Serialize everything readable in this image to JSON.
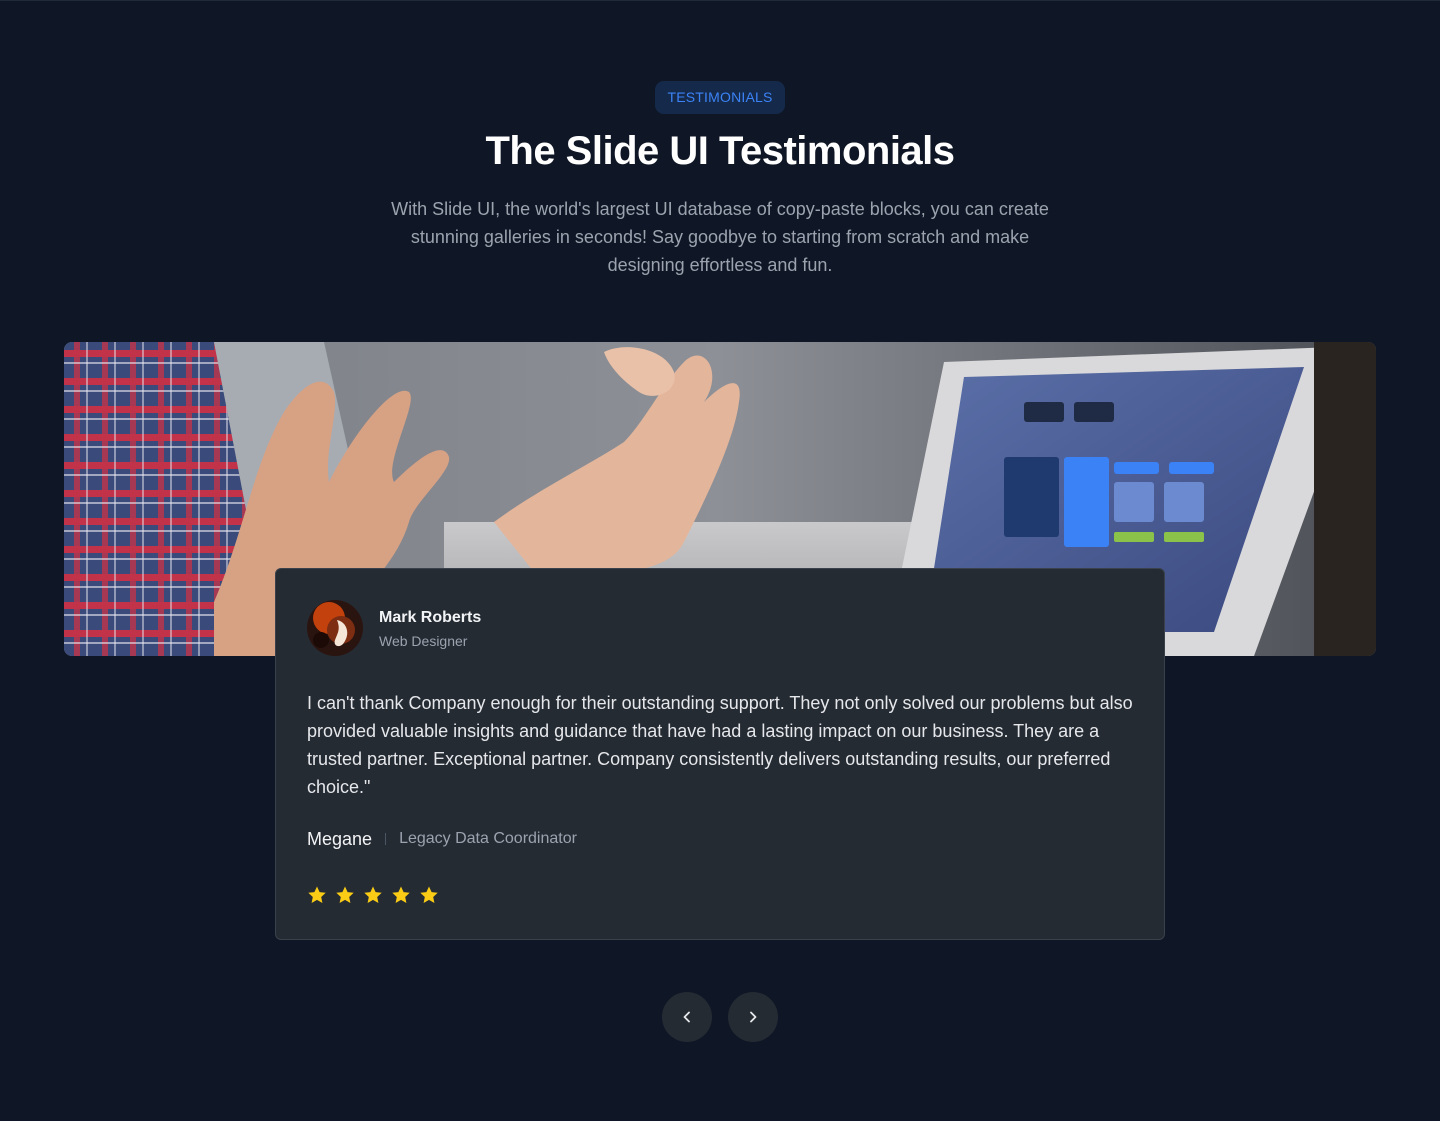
{
  "section": {
    "badge": "TESTIMONIALS",
    "title": "The Slide UI Testimonials",
    "subtitle": "With Slide UI, the world's largest UI database of copy-paste blocks, you can create stunning galleries in seconds! Say goodbye to starting from scratch and make designing effortless and fun."
  },
  "testimonial": {
    "author_name": "Mark Roberts",
    "author_role": "Web Designer",
    "quote": "I can't thank Company enough for their outstanding support. They not only solved our problems but also provided valuable insights and guidance that have had a lasting impact on our business. They are a trusted partner. Exceptional partner. Company consistently delivers outstanding results, our preferred choice.\"",
    "reviewer_name": "Megane",
    "reviewer_title": "Legacy Data Coordinator",
    "rating": 5
  },
  "icons": {
    "star": "star-icon",
    "prev": "chevron-left-icon",
    "next": "chevron-right-icon"
  },
  "colors": {
    "background": "#0f1625",
    "card": "#252b33",
    "accent": "#3b82f6",
    "star": "#facc15"
  }
}
